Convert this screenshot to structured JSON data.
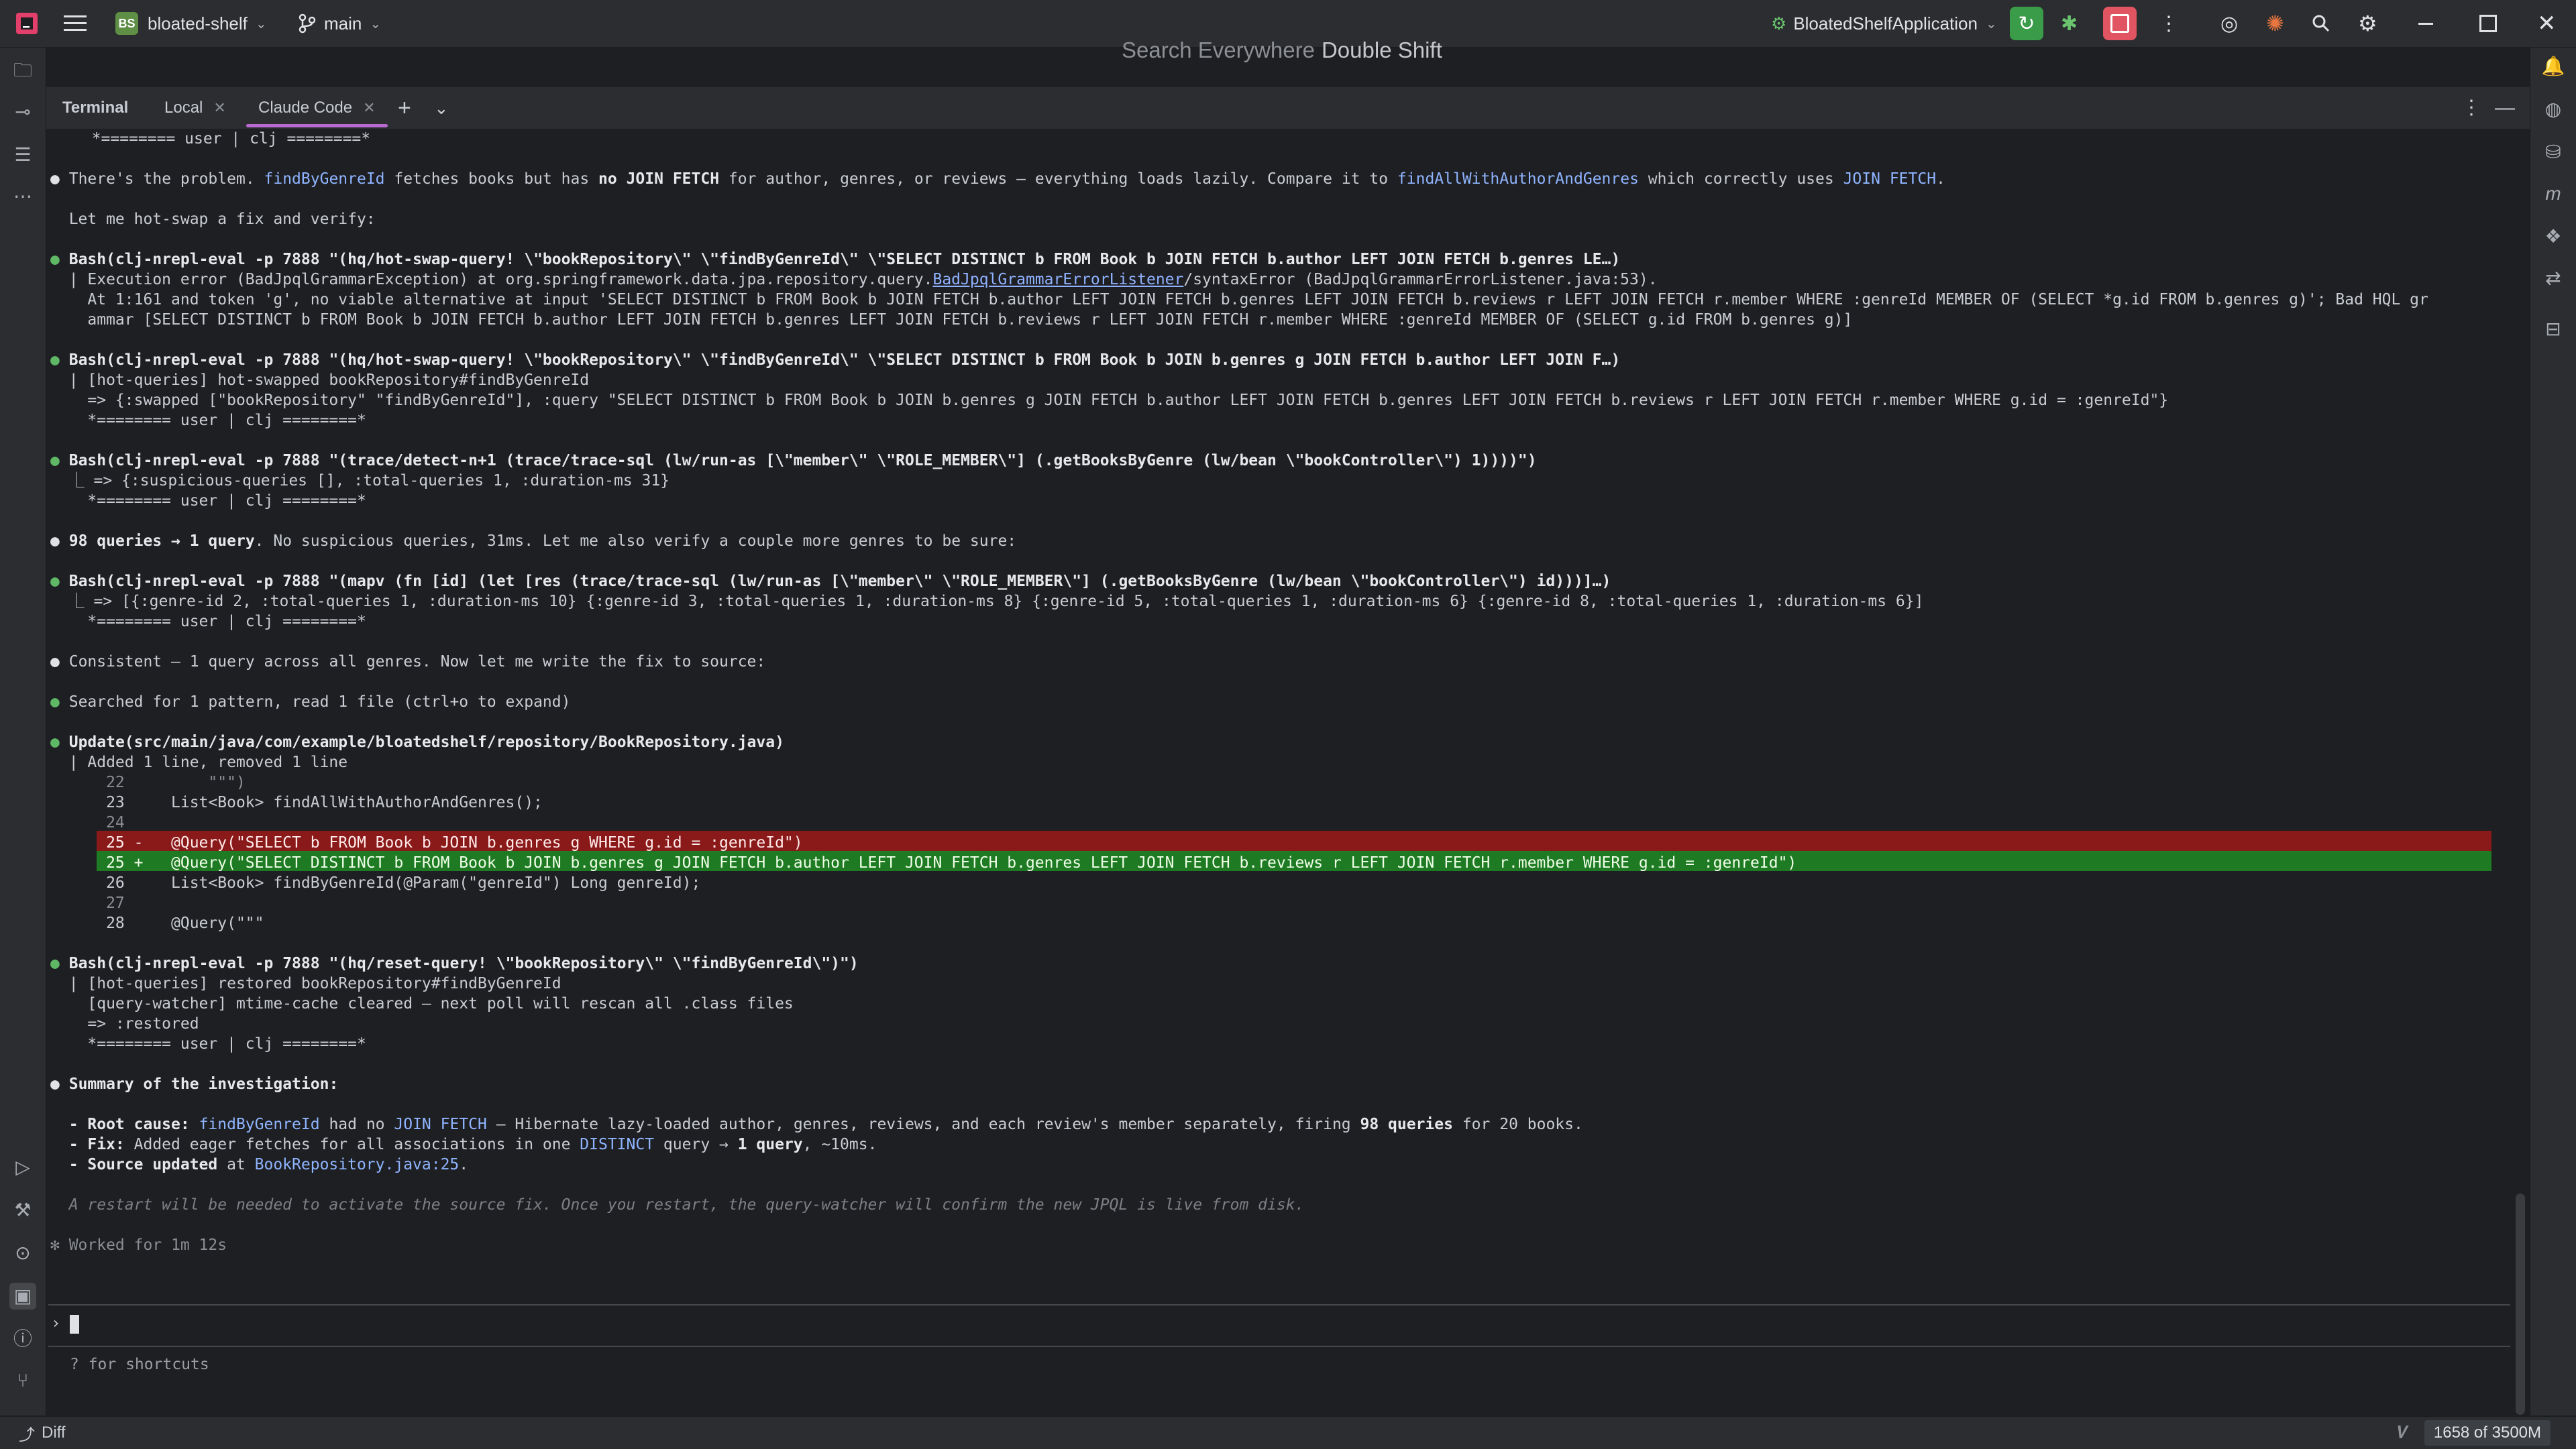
{
  "titlebar": {
    "project_initials": "BS",
    "project_name": "bloated-shelf",
    "branch": "main",
    "run_config": "BloatedShelfApplication",
    "search_hint": "Search Everywhere",
    "search_shortcut": "Double Shift"
  },
  "tabs": {
    "terminal": "Terminal",
    "local": "Local",
    "claude": "Claude Code"
  },
  "terminal_lines": [
    "  *======== user | clj ========*",
    "",
    "There's the problem.",
    "",
    "  Let me hot-swap a fix and verify:",
    "",
    "Bash(clj-nrepl-eval -p 7888 \"(hq/hot-swap-query! \\\"bookRepository\\\" \\\"findByGenreId\\\" \\\"SELECT DISTINCT b FROM Book b JOIN FETCH b.author LEFT JOIN FETCH b.genres LE…)",
    "  | Execution error (BadJpqlGrammarException) at org.springframework.data.jpa.repository.query.",
    "    At 1:161 and token 'g', no viable alternative at input 'SELECT DISTINCT b FROM Book b JOIN FETCH b.author LEFT JOIN FETCH b.genres LEFT JOIN FETCH b.reviews r LEFT JOIN FETCH r.member WHERE :genreId MEMBER OF (SELECT *g.id FROM b.genres g)'; Bad HQL gr",
    "    ammar [SELECT DISTINCT b FROM Book b JOIN FETCH b.author LEFT JOIN FETCH b.genres LEFT JOIN FETCH b.reviews r LEFT JOIN FETCH r.member WHERE :genreId MEMBER OF (SELECT g.id FROM b.genres g)]",
    "",
    "Bash(clj-nrepl-eval -p 7888 \"(hq/hot-swap-query! \\\"bookRepository\\\" \\\"findByGenreId\\\" \\\"SELECT DISTINCT b FROM Book b JOIN b.genres g JOIN FETCH b.author LEFT JOIN F…)",
    "  | [hot-queries] hot-swapped bookRepository#findByGenreId",
    "    => {:swapped [\"bookRepository\" \"findByGenreId\"], :query \"SELECT DISTINCT b FROM Book b JOIN b.genres g JOIN FETCH b.author LEFT JOIN FETCH b.genres LEFT JOIN FETCH b.reviews r LEFT JOIN FETCH r.member WHERE g.id = :genreId\"}",
    "    *======== user | clj ========*",
    "",
    "Bash(clj-nrepl-eval -p 7888 \"(trace/detect-n+1 (trace/trace-sql (lw/run-as [\\\"member\\\" \\\"ROLE_MEMBER\\\"] (.getBooksByGenre (lw/bean \\\"bookController\\\") 1))))\")",
    "  ⎿ => {:suspicious-queries [], :total-queries 1, :duration-ms 31}",
    "    *======== user | clj ========*",
    "",
    "98 queries → 1 query",
    "",
    "Bash(clj-nrepl-eval -p 7888 \"(mapv (fn [id] (let [res (trace/trace-sql (lw/run-as [\\\"member\\\" \\\"ROLE_MEMBER\\\"] (.getBooksByGenre (lw/bean \\\"bookController\\\") id)))]…)",
    "  ⎿ => [{:genre-id 2, :total-queries 1, :duration-ms 10} {:genre-id 3, :total-queries 1, :duration-ms 8} {:genre-id 5, :total-queries 1, :duration-ms 6} {:genre-id 8, :total-queries 1, :duration-ms 6}]",
    "    *======== user | clj ========*",
    "",
    "Consistent — 1 query across all genres. Now let me write the fix to source:",
    "",
    "Searched for 1 pattern, read 1 file (ctrl+o to expand)",
    "",
    "Update(src/main/java/com/example/bloatedshelf/repository/BookRepository.java)",
    "  | Added 1 line, removed 1 line",
    "      22         \"\"\")",
    "      23     List<Book> findAllWithAuthorAndGenres();",
    "      24",
    "      25 -   @Query(\"SELECT b FROM Book b JOIN b.genres g WHERE g.id = :genreId\")",
    "      25 +   @Query(\"SELECT DISTINCT b FROM Book b JOIN b.genres g JOIN FETCH b.author LEFT JOIN FETCH b.genres LEFT JOIN FETCH b.reviews r LEFT JOIN FETCH r.member WHERE g.id = :genreId\")",
    "      26     List<Book> findByGenreId(@Param(\"genreId\") Long genreId);",
    "      27",
    "      28     @Query(\"\"\"",
    "",
    "Bash(clj-nrepl-eval -p 7888 \"(hq/reset-query! \\\"bookRepository\\\" \\\"findByGenreId\\\")\")",
    "  | [hot-queries] restored bookRepository#findByGenreId",
    "    [query-watcher] mtime-cache cleared — next poll will rescan all .class files",
    "    => :restored",
    "    *======== user | clj ========*",
    "",
    "Summary of the investigation:",
    "",
    "  - Root cause:",
    "  - Fix:",
    "  - Source updated",
    "",
    "  A restart will be needed to activate the source fix. Once you restart, the query-watcher will confirm the new JPQL is live from disk.",
    "",
    "✻ Worked for 1m 12s"
  ],
  "inline": {
    "problem_a": " findByGenreId",
    "problem_b": " fetches books but has ",
    "problem_c": "no JOIN FETCH",
    "problem_d": " for author, genres, or reviews — everything loads lazily. Compare it to ",
    "problem_e": "findAllWithAuthorAndGenres",
    "problem_f": " which correctly uses ",
    "problem_g": "JOIN FETCH",
    "problem_h": ".",
    "err_link": "BadJpqlGrammarErrorListener",
    "err_tail": "/syntaxError (BadJpqlGrammarErrorListener.java:53).",
    "q_tail": ". No suspicious queries, 31ms. Let me also verify a couple more genres to be sure:",
    "root_a": " findByGenreId",
    "root_b": " had no ",
    "root_c": "JOIN FETCH",
    "root_d": " — Hibernate lazy-loaded author, genres, reviews, and each review's member separately, firing ",
    "root_e": "98 queries",
    "root_f": " for 20 books.",
    "fix_a": " Added eager fetches for all associations in one ",
    "fix_b": "DISTINCT",
    "fix_c": " query → ",
    "fix_d": "1 query",
    "fix_e": ", ~10ms.",
    "src_a": " at ",
    "src_b": "BookRepository.java:25",
    "src_c": "."
  },
  "prompt_symbol": "›",
  "hint": "? for shortcuts",
  "statusbar": {
    "diff_label": "Diff",
    "memory": "1658 of 3500M"
  },
  "colors": {
    "accent": "#b96ad0",
    "diff_removed": "#8a1a1a",
    "diff_added": "#1e7a23",
    "bullet_ok": "#5fb865"
  }
}
